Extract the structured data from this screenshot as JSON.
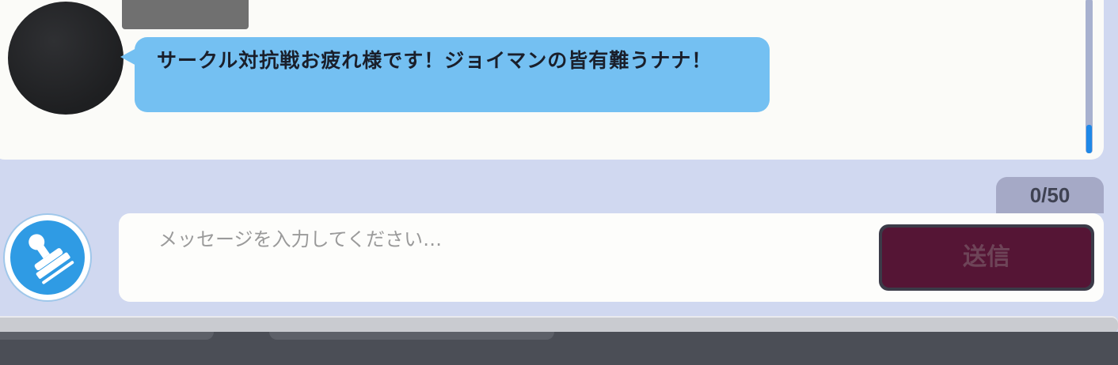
{
  "chat": {
    "message": {
      "text": "サークル対抗戦お疲れ様です！ジョイマンの皆有難うナナ！"
    }
  },
  "composer": {
    "char_count": "0/50",
    "placeholder": "メッセージを入力してください…",
    "send_label": "送信",
    "stamp_icon": "stamp-icon"
  },
  "colors": {
    "bubble": "#74c0f2",
    "send_button": "#551535",
    "panel_background": "#d0d8f0",
    "scroll_accent": "#1e88e8"
  }
}
